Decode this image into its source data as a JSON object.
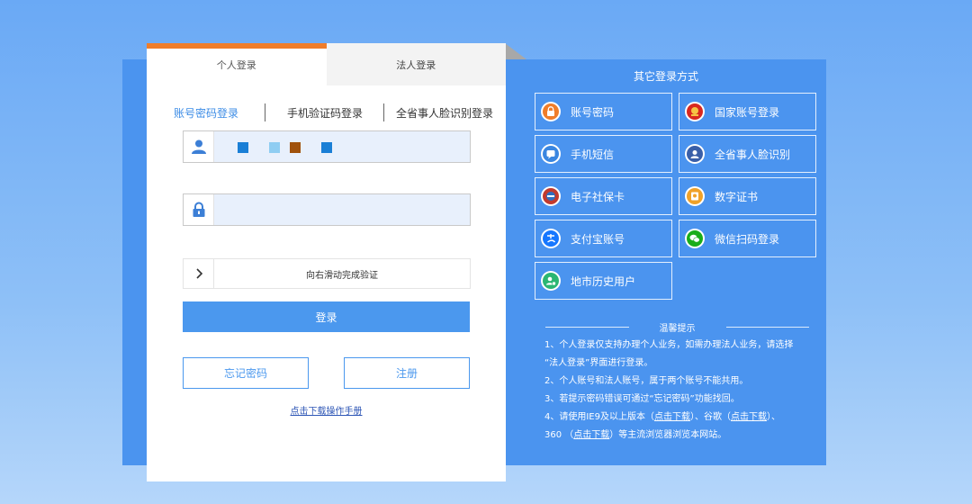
{
  "tabs": [
    {
      "label": "个人登录",
      "active": true
    },
    {
      "label": "法人登录",
      "active": false
    }
  ],
  "subtabs": [
    "账号密码登录",
    "手机验证码登录",
    "全省事人脸识别登录"
  ],
  "fields": {
    "username_placeholder": "",
    "password_placeholder": ""
  },
  "slider": {
    "text": "向右滑动完成验证"
  },
  "buttons": {
    "login": "登录",
    "forgot": "忘记密码",
    "register": "注册"
  },
  "manual_link": "点击下载操作手册",
  "other": {
    "title": "其它登录方式",
    "options": [
      {
        "label": "账号密码",
        "icon": "lock-icon",
        "color": "#f07d2a"
      },
      {
        "label": "国家账号登录",
        "icon": "national-emblem-icon",
        "color": "#d9281f"
      },
      {
        "label": "手机短信",
        "icon": "sms-icon",
        "color": "#3a86e0"
      },
      {
        "label": "全省事人脸识别",
        "icon": "face-scan-icon",
        "color": "#3a86e0"
      },
      {
        "label": "电子社保卡",
        "icon": "social-security-card-icon",
        "color": "#c23a2e"
      },
      {
        "label": "数字证书",
        "icon": "digital-certificate-icon",
        "color": "#f0a22a"
      },
      {
        "label": "支付宝账号",
        "icon": "alipay-icon",
        "color": "#1677ff"
      },
      {
        "label": "微信扫码登录",
        "icon": "wechat-icon",
        "color": "#1aad19"
      },
      {
        "label": "地市历史用户",
        "icon": "history-user-icon",
        "color": "#2bb673"
      }
    ]
  },
  "tips": {
    "title": "温馨提示",
    "line1a": "1、个人登录仅支持办理个人业务，如需办理法人业务，请选择",
    "line1b": "“法人登录”界面进行登录。",
    "line2": "2、个人账号和法人账号，属于两个账号不能共用。",
    "line3": "3、若提示密码错误可通过“忘记密码”功能找回。",
    "line4_pre": "4、请使用IE9及以上版本（",
    "line4_link1": "点击下载",
    "line4_mid": "）、谷歌（",
    "line4_link2": "点击下载",
    "line4_end": "）、",
    "line5_pre": "360 （",
    "line5_link": "点击下载",
    "line5_end": "）等主流浏览器浏览本网站。"
  },
  "colors": {
    "accent": "#4b98ee",
    "tab_indicator": "#f07d2a",
    "panel": "#4b94ef"
  }
}
